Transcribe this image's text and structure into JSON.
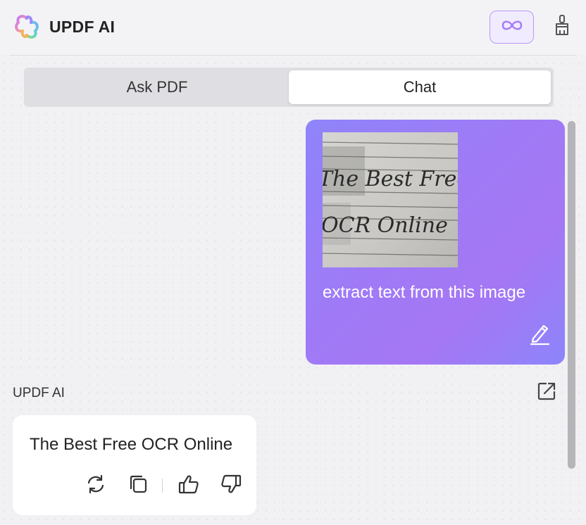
{
  "header": {
    "title": "UPDF AI",
    "logo_icon": "updf-flower-logo-icon",
    "infinity_icon": "infinity-icon",
    "clean_icon": "broom-icon",
    "accent_color": "#a77cf6"
  },
  "tabs": [
    {
      "label": "Ask PDF",
      "active": false
    },
    {
      "label": "Chat",
      "active": true
    }
  ],
  "user_message": {
    "image_icon": "handwritten-note-image",
    "image_handwriting": [
      "The Best Free",
      "OCR Online"
    ],
    "text": "extract text from this image",
    "edit_icon": "pencil-icon",
    "gradient": [
      "#8f84fb",
      "#a577f4"
    ]
  },
  "ai_message": {
    "sender": "UPDF AI",
    "text": "The Best Free OCR Online",
    "export_icon": "external-link-icon",
    "actions": [
      {
        "name": "regenerate",
        "icon": "refresh-icon"
      },
      {
        "name": "copy",
        "icon": "copy-icon"
      },
      {
        "name": "like",
        "icon": "thumbs-up-icon"
      },
      {
        "name": "dislike",
        "icon": "thumbs-down-icon"
      }
    ]
  }
}
